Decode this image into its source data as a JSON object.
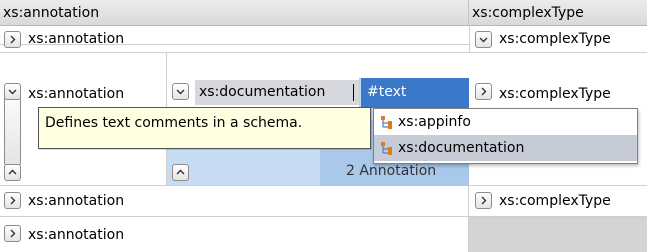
{
  "headers": {
    "col1": "xs:annotation",
    "col2": "xs:complexType"
  },
  "rows": {
    "row1": {
      "label": "xs:annotation",
      "right": "xs:complexType"
    },
    "row2": {
      "label": "xs:annotation",
      "editor_label": "xs:documentation",
      "text_cell": "#text",
      "right": "xs:complexType",
      "partial_text": "2 Annotation"
    },
    "row3": {
      "label": "xs:annotation",
      "right": "xs:complexType"
    },
    "row4": {
      "label": "xs:annotation"
    }
  },
  "tooltip": "Defines text comments in a schema.",
  "popup": {
    "items": [
      {
        "label": "xs:appinfo",
        "icon": "tree-element-icon",
        "selected": false
      },
      {
        "label": "xs:documentation",
        "icon": "tree-element-icon",
        "selected": true
      }
    ]
  },
  "colors": {
    "selection_blue": "#3a78c9",
    "nested_blue": "#c7dcf2",
    "tooltip_bg": "#ffffe1",
    "popup_selected": "#c6cbd6",
    "empty_gray": "#d4d4d4"
  }
}
